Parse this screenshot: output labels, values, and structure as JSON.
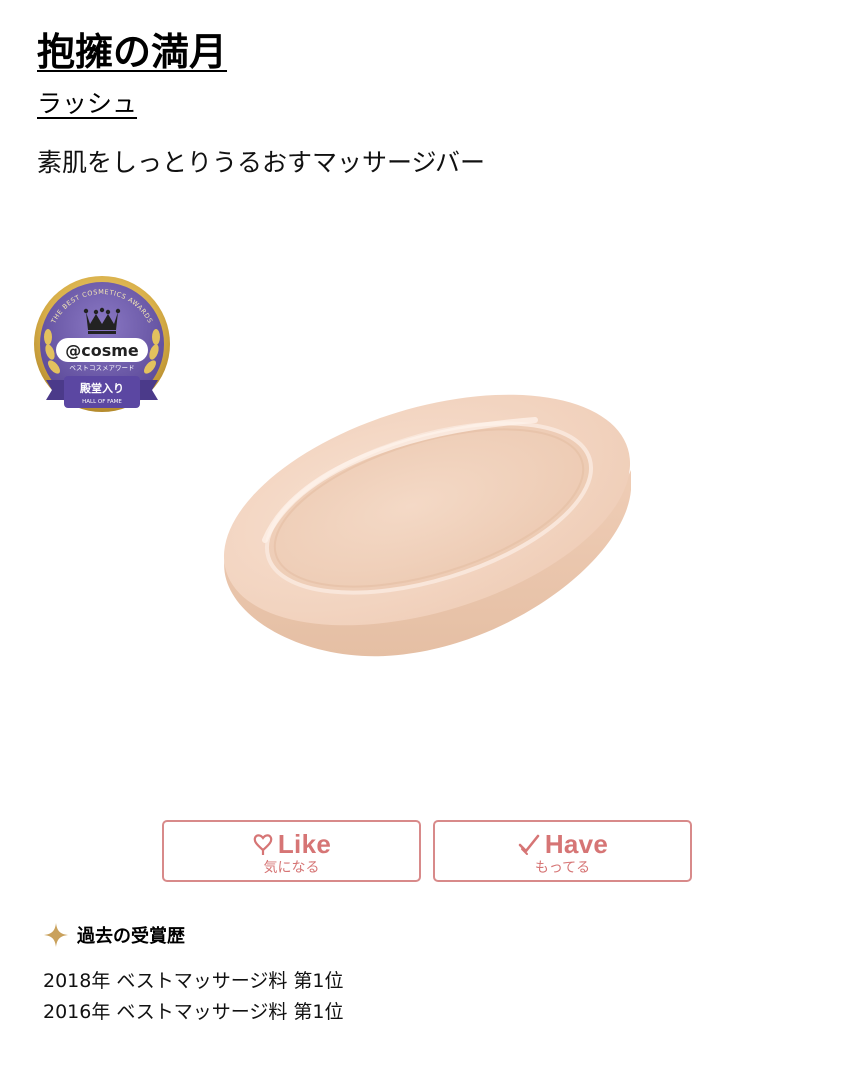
{
  "product": {
    "name": "抱擁の満月",
    "brand": "ラッシュ",
    "catchcopy": "素肌をしっとりうるおすマッサージバー"
  },
  "badge": {
    "arc_text": "THE BEST COSMETICS AWARDS",
    "logo": "@cosme",
    "subtitle": "ベストコスメアワード",
    "ribbon": "殿堂入り",
    "ribbon_sub": "HALL OF FAME"
  },
  "buttons": {
    "like": {
      "label": "Like",
      "sub": "気になる",
      "icon": "heart-icon"
    },
    "have": {
      "label": "Have",
      "sub": "もってる",
      "icon": "check-icon"
    }
  },
  "awards": {
    "heading": "過去の受賞歴",
    "items": [
      "2018年 ベストマッサージ料 第1位",
      "2016年 ベストマッサージ料 第1位"
    ]
  },
  "colors": {
    "button_accent": "#d67575",
    "badge_purple": "#6a56a6",
    "badge_gold": "#d9b04a",
    "soap": "#f1d2bd"
  }
}
